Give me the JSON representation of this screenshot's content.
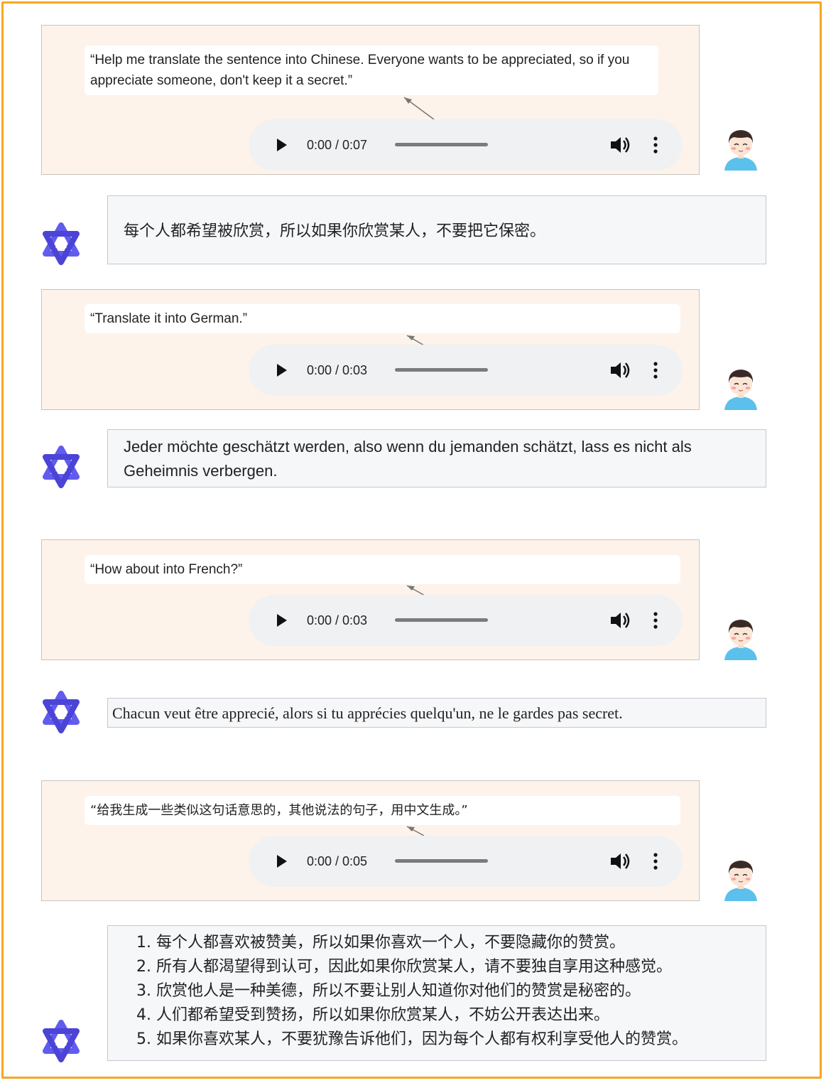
{
  "conversation": [
    {
      "user": {
        "prompt": "“Help me translate the sentence into Chinese. Everyone wants to be appreciated, so if you appreciate someone, don't keep it a secret.”",
        "audio_time": "0:00 / 0:07"
      },
      "assistant": {
        "text": "每个人都希望被欣赏，所以如果你欣赏某人，不要把它保密。"
      }
    },
    {
      "user": {
        "prompt": "“Translate it into German.”",
        "audio_time": "0:00 / 0:03"
      },
      "assistant": {
        "text": "Jeder möchte geschätzt werden, also wenn du jemanden schätzt, lass es nicht als Geheimnis verbergen."
      }
    },
    {
      "user": {
        "prompt": "“How about into French?”",
        "audio_time": "0:00 / 0:03"
      },
      "assistant": {
        "text": "Chacun veut être apprecié, alors si tu apprécies quelqu'un, ne le gardes pas secret."
      }
    },
    {
      "user": {
        "prompt": "“给我生成一些类似这句话意思的，其他说法的句子，用中文生成。”",
        "audio_time": "0:00 / 0:05"
      },
      "assistant": {
        "items": [
          "1.  每个人都喜欢被赞美，所以如果你喜欢一个人，不要隐藏你的赞赏。",
          "2.  所有人都渴望得到认可，因此如果你欣赏某人，请不要独自享用这种感觉。",
          "3.  欣赏他人是一种美德，所以不要让别人知道你对他们的赞赏是秘密的。",
          "4.  人们都希望受到赞扬，所以如果你欣赏某人，不妨公开表达出来。",
          "5.  如果你喜欢某人，不要犹豫告诉他们，因为每个人都有权利享受他人的赞赏。"
        ]
      }
    }
  ],
  "colors": {
    "frame": "#f5a623",
    "user_bg": "#fdf3ea",
    "bot_bg": "#f6f7f9",
    "logo": "#615ced",
    "avatar_shirt": "#5bc0eb"
  }
}
